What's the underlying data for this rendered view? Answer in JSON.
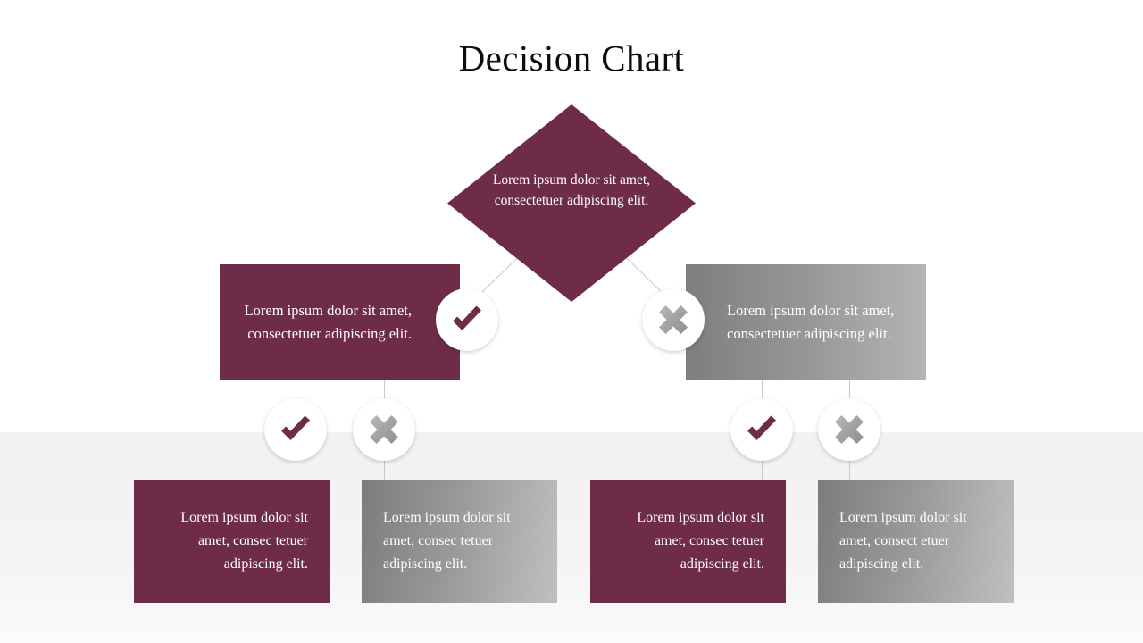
{
  "slide": {
    "title": "Decision Chart",
    "background_color": "#ffffff",
    "band_color": "#f2f2f2",
    "accent_color": "#6e2c48",
    "neutral_color": "#949494"
  },
  "decision": {
    "text": "Lorem ipsum dolor sit amet, consectetuer adipiscing elit."
  },
  "branches": [
    {
      "id": "yes-branch",
      "badge": "check-icon",
      "text": "Lorem ipsum dolor sit amet, consectetuer adipiscing elit.",
      "color": "#6e2c48"
    },
    {
      "id": "no-branch",
      "badge": "cross-icon",
      "text": "Lorem ipsum dolor sit amet, consectetuer adipiscing elit.",
      "color": "#949494"
    }
  ],
  "outcomes": [
    {
      "id": "outcome-1",
      "badge": "check-icon",
      "text": "Lorem ipsum dolor sit amet, consec tetuer adipiscing elit.",
      "color": "#6e2c48"
    },
    {
      "id": "outcome-2",
      "badge": "cross-icon",
      "text": "Lorem ipsum dolor sit amet, consec tetuer adipiscing elit.",
      "color": "#949494"
    },
    {
      "id": "outcome-3",
      "badge": "check-icon",
      "text": "Lorem ipsum dolor sit amet, consec tetuer adipiscing elit.",
      "color": "#6e2c48"
    },
    {
      "id": "outcome-4",
      "badge": "cross-icon",
      "text": "Lorem ipsum dolor sit amet, consect etuer adipiscing elit.",
      "color": "#949494"
    }
  ]
}
